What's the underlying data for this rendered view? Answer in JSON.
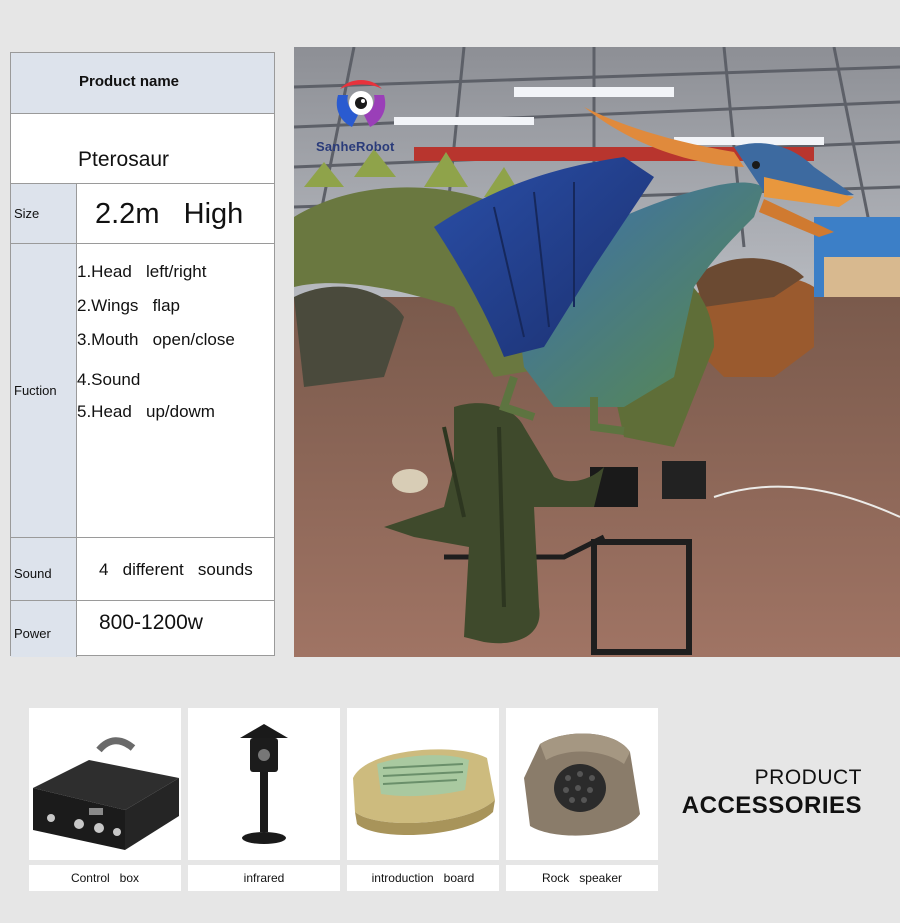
{
  "spec": {
    "header": "Product  name",
    "product_name": "Pterosaur",
    "size_label": "Size",
    "size_value": "2.2m   High",
    "function_label": "Fuction",
    "functions": [
      "1.Head   left/right",
      "2.Wings   flap",
      "3.Mouth   open/close",
      "4.Sound",
      "5.Head   up/dowm"
    ],
    "sound_label": "Sound",
    "sound_value": "4   different   sounds",
    "power_label": "Power",
    "power_value": "800-1200w"
  },
  "photo": {
    "brand": "SanheRobot",
    "colors": {
      "brand_red": "#e8323c",
      "brand_blue": "#2a5bd0",
      "brand_purple": "#9a3fb8"
    }
  },
  "accessories": {
    "title_line1": "PRODUCT",
    "title_line2": "ACCESSORIES",
    "items": [
      {
        "label": "Control   box",
        "icon": "control-box-icon"
      },
      {
        "label": "infrared",
        "icon": "infrared-sensor-icon"
      },
      {
        "label": "introduction   board",
        "icon": "introduction-board-icon"
      },
      {
        "label": "Rock   speaker",
        "icon": "rock-speaker-icon"
      }
    ]
  }
}
